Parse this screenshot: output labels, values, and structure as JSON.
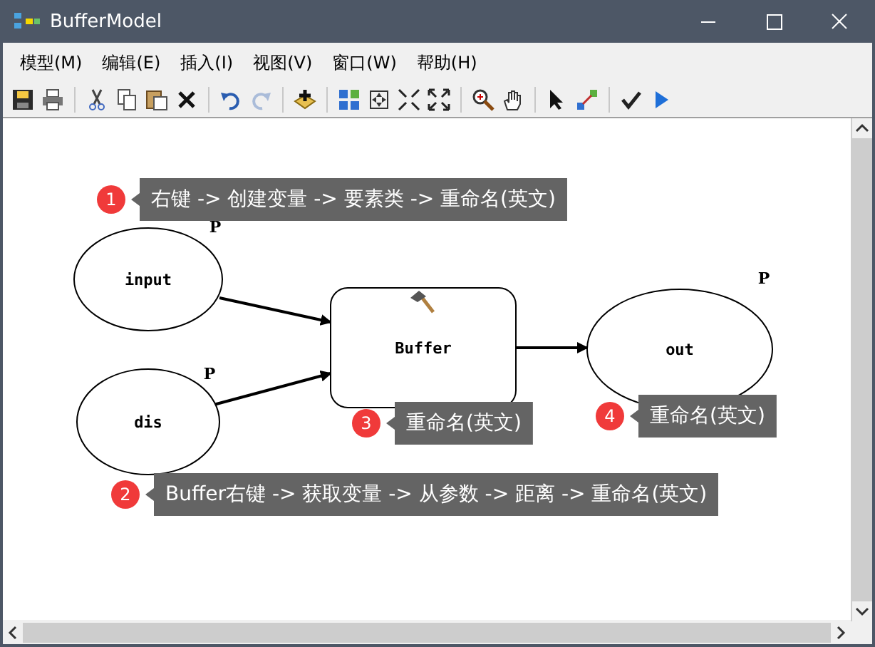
{
  "window": {
    "title": "BufferModel"
  },
  "menu": [
    {
      "label": "模型(M)"
    },
    {
      "label": "编辑(E)"
    },
    {
      "label": "插入(I)"
    },
    {
      "label": "视图(V)"
    },
    {
      "label": "窗口(W)"
    },
    {
      "label": "帮助(H)"
    }
  ],
  "toolbar": [
    {
      "kind": "save",
      "disabled": false
    },
    {
      "kind": "print",
      "disabled": false
    },
    {
      "kind": "separator"
    },
    {
      "kind": "cut",
      "disabled": false
    },
    {
      "kind": "copy",
      "disabled": false
    },
    {
      "kind": "paste",
      "disabled": false
    },
    {
      "kind": "delete",
      "disabled": false
    },
    {
      "kind": "separator"
    },
    {
      "kind": "undo",
      "disabled": false
    },
    {
      "kind": "redo",
      "disabled": true
    },
    {
      "kind": "separator"
    },
    {
      "kind": "add",
      "disabled": false
    },
    {
      "kind": "separator"
    },
    {
      "kind": "layout",
      "disabled": false
    },
    {
      "kind": "extent",
      "disabled": false
    },
    {
      "kind": "shrink",
      "disabled": false
    },
    {
      "kind": "expand",
      "disabled": false
    },
    {
      "kind": "separator"
    },
    {
      "kind": "zoom",
      "disabled": false
    },
    {
      "kind": "pan",
      "disabled": false
    },
    {
      "kind": "separator"
    },
    {
      "kind": "select",
      "disabled": false
    },
    {
      "kind": "connect",
      "disabled": false
    },
    {
      "kind": "separator"
    },
    {
      "kind": "validate",
      "disabled": false
    },
    {
      "kind": "run",
      "disabled": false
    }
  ],
  "diagram": {
    "nodes": [
      {
        "kind": "variable",
        "label": "input",
        "parameter": "P"
      },
      {
        "kind": "variable",
        "label": "dis",
        "parameter": "P"
      },
      {
        "kind": "tool",
        "label": "Buffer"
      },
      {
        "kind": "variable",
        "label": "out",
        "parameter": "P"
      }
    ],
    "callouts": [
      {
        "number": "1",
        "text": "右键 -> 创建变量 -> 要素类 -> 重命名(英文)"
      },
      {
        "number": "3",
        "text": "重命名(英文)"
      },
      {
        "number": "4",
        "text": "重命名(英文)"
      },
      {
        "number": "2",
        "text": "Buffer右键 -> 获取变量 -> 从参数 -> 距离 -> 重命名(英文)"
      }
    ]
  }
}
